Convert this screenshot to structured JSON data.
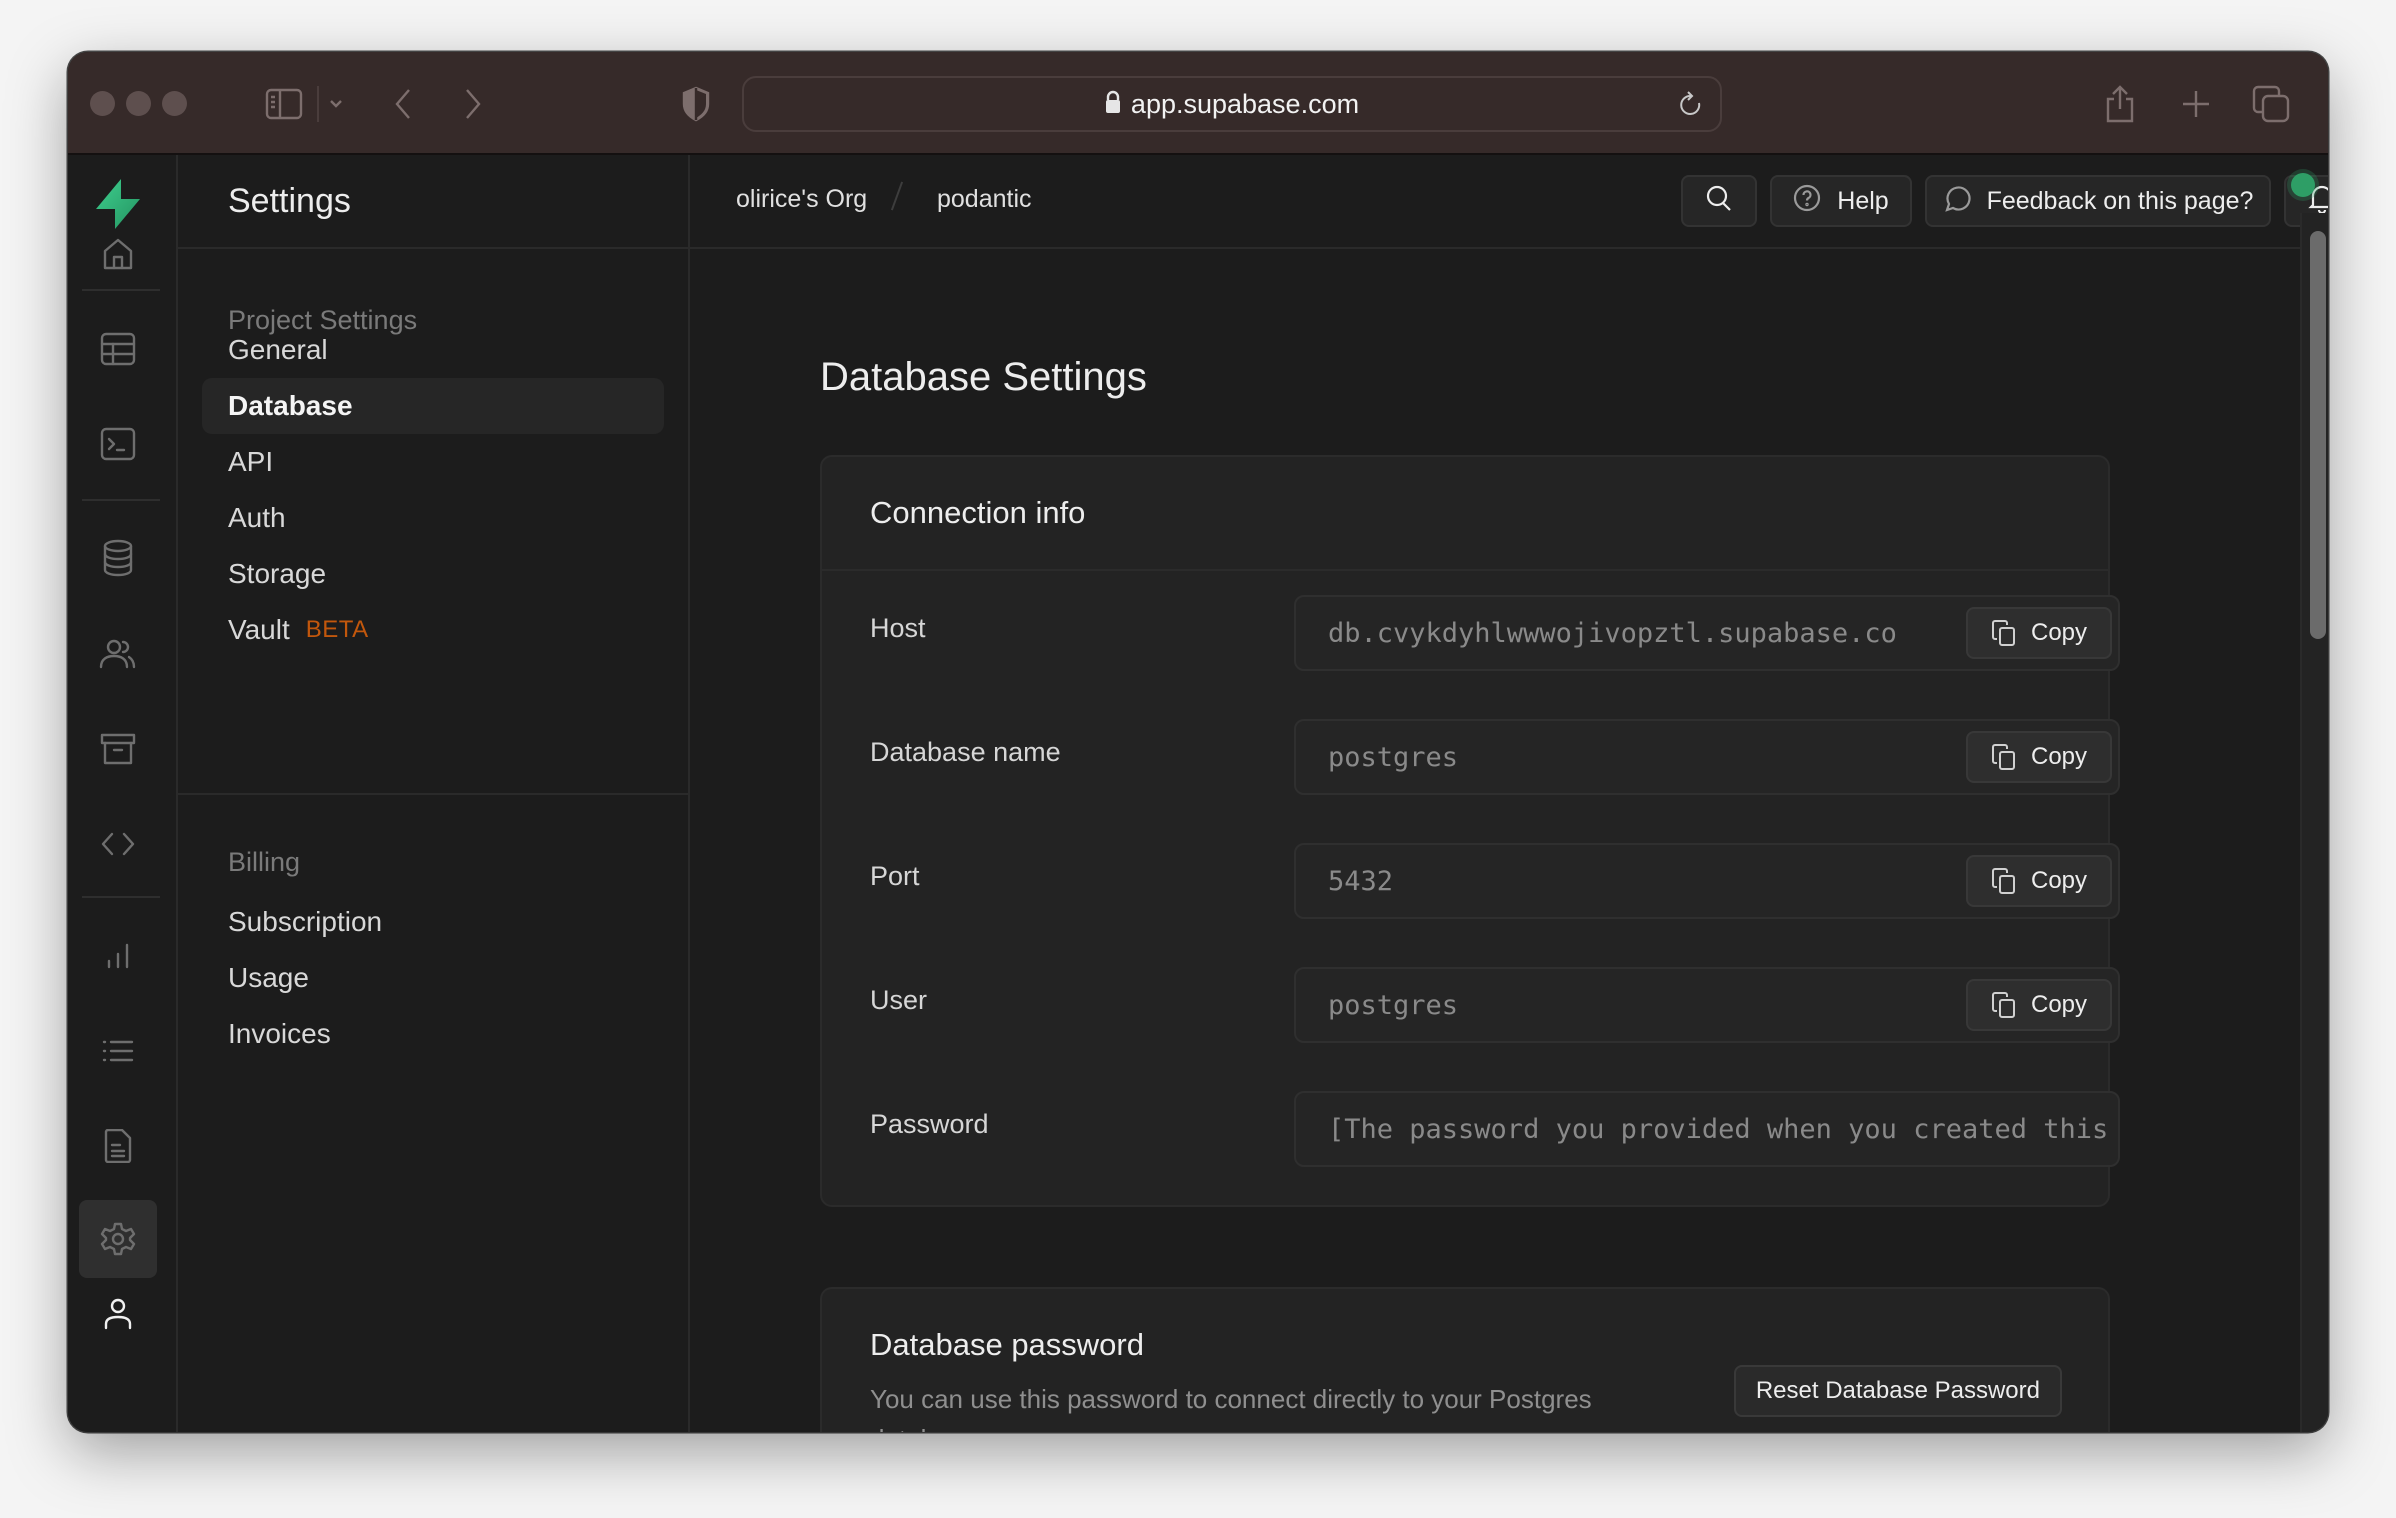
{
  "browser": {
    "url": "app.supabase.com",
    "icons": [
      "window-close",
      "window-minimize",
      "window-zoom",
      "sidebar-toggle-icon",
      "chevron-down-icon",
      "back-icon",
      "forward-icon",
      "shield-icon",
      "lock-icon",
      "reload-icon",
      "share-icon",
      "new-tab-icon",
      "tabs-overview-icon"
    ]
  },
  "rail": {
    "items": [
      "home",
      "table-editor",
      "sql-editor",
      "database",
      "authentication",
      "storage",
      "edge-functions",
      "reports",
      "logs",
      "api-docs",
      "settings",
      "profile"
    ],
    "active": "settings",
    "brand_color": "#3ecf8e"
  },
  "sidebar": {
    "title": "Settings",
    "groups": [
      {
        "title": "Project Settings",
        "items": [
          {
            "label": "General"
          },
          {
            "label": "Database",
            "active": true
          },
          {
            "label": "API"
          },
          {
            "label": "Auth"
          },
          {
            "label": "Storage"
          },
          {
            "label": "Vault",
            "badge": "BETA"
          }
        ]
      },
      {
        "title": "Billing",
        "items": [
          {
            "label": "Subscription"
          },
          {
            "label": "Usage"
          },
          {
            "label": "Invoices"
          }
        ]
      }
    ]
  },
  "topbar": {
    "breadcrumb": [
      "olirice's Org",
      "podantic"
    ],
    "help_label": "Help",
    "feedback_label": "Feedback on this page?",
    "notification_status_color": "#2e9e66"
  },
  "page": {
    "title": "Database Settings",
    "connection": {
      "title": "Connection info",
      "copy_label": "Copy",
      "fields": [
        {
          "label": "Host",
          "value": "db.cvykdyhlwwwojivopztl.supabase.co"
        },
        {
          "label": "Database name",
          "value": "postgres"
        },
        {
          "label": "Port",
          "value": "5432"
        },
        {
          "label": "User",
          "value": "postgres"
        },
        {
          "label": "Password",
          "value": "[The password you provided when you created this project]"
        }
      ]
    },
    "password_card": {
      "title": "Database password",
      "description": "You can use this password to connect directly to your Postgres database.",
      "reset_label": "Reset Database Password"
    }
  },
  "colors": {
    "accent": "#3ecf8e",
    "beta": "#c2570c",
    "background": "#1c1c1c",
    "card": "#232323"
  }
}
